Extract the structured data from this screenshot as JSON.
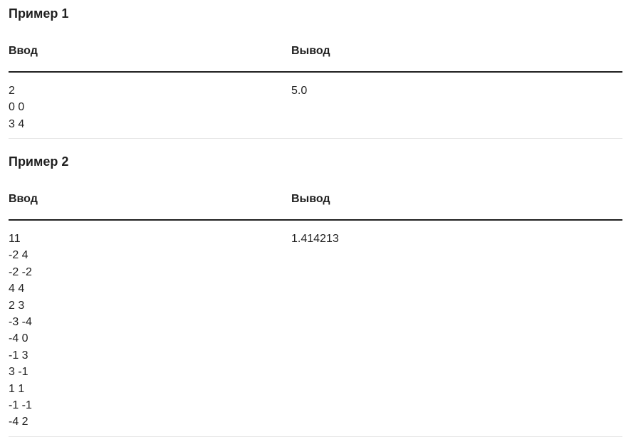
{
  "examples": [
    {
      "title": "Пример 1",
      "input_header": "Ввод",
      "output_header": "Вывод",
      "input_lines": [
        "2",
        "0 0",
        "3 4"
      ],
      "output_lines": [
        "5.0"
      ]
    },
    {
      "title": "Пример 2",
      "input_header": "Ввод",
      "output_header": "Вывод",
      "input_lines": [
        "11",
        "-2 4",
        "-2 -2",
        "4 4",
        "2 3",
        "-3 -4",
        "-4 0",
        "-1 3",
        "3 -1",
        "1 1",
        "-1 -1",
        "-4 2"
      ],
      "output_lines": [
        "1.414213"
      ]
    }
  ]
}
